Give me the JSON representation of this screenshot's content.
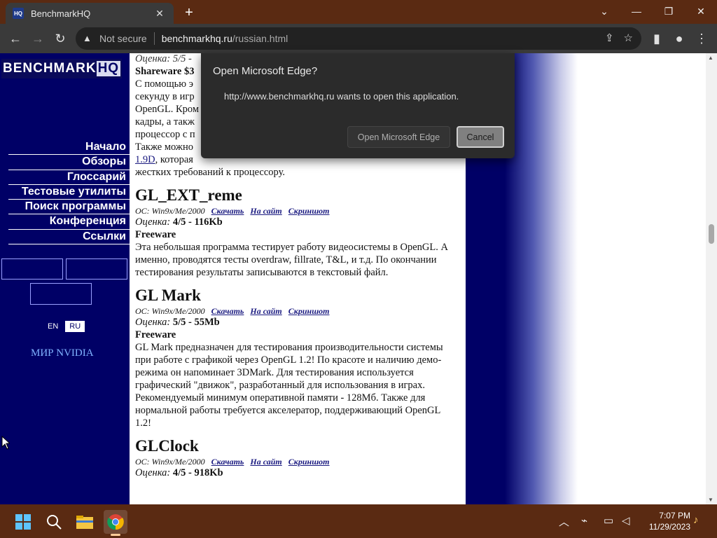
{
  "browser": {
    "tab_title": "BenchmarkHQ",
    "tab_favicon": "HQ",
    "address_security": "Not secure",
    "address_host": "benchmarkhq.ru",
    "address_path": "/russian.html"
  },
  "site": {
    "logo_main": "BENCHMARK",
    "logo_hq": "HQ",
    "nav": [
      "Начало",
      "Обзоры",
      "Глоссарий",
      "Тестовые утилиты",
      "Поиск программы",
      "Конференция",
      "Ссылки"
    ],
    "lang_en": "EN",
    "lang_ru": "RU",
    "mir_nvidia": "МИР NVIDIA"
  },
  "content": {
    "top_rating": "Оценка: 5/5 -",
    "top_license": "Shareware $3",
    "top_lines": [
      "С помощью э",
      "секунду в игр",
      "OpenGL. Кром",
      "кадры, а такж",
      "процессор с п",
      "Также можно"
    ],
    "top_link": "1.9D",
    "top_link_rest": ", которая",
    "top_last": "жестких требований к процессору.",
    "entries": [
      {
        "title": "GL_EXT_reme",
        "os": "ОС: Win9x/Me/2000",
        "download": "Скачать",
        "site": "На сайт",
        "screenshot": "Скриншот",
        "rating_label": "Оценка:",
        "rating_value": "4/5 - 116Kb",
        "license": "Freeware",
        "desc": "Эта небольшая программа тестирует работу видеосистемы в OpenGL. А именно, проводятся тесты overdraw, fillrate, T&L, и т.д. По окончании тестирования результаты записываются в текстовый файл."
      },
      {
        "title": "GL Mark",
        "os": "ОС: Win9x/Me/2000",
        "download": "Скачать",
        "site": "На сайт",
        "screenshot": "Скриншот",
        "rating_label": "Оценка:",
        "rating_value": "5/5 - 55Mb",
        "license": "Freeware",
        "desc": "GL Mark предназначен для тестирования производительности системы при работе с графикой через OpenGL 1.2! По красоте и наличию демо-режима он напоминает 3DMark. Для тестирования используется графический \"движок\", разработанный для использования в играх. Рекомендуемый минимум оперативной памяти - 128Мб. Также для нормальной работы требуется акселератор, поддерживающий OpenGL 1.2!"
      },
      {
        "title": "GLClock",
        "os": "ОС: Win9x/Me/2000",
        "download": "Скачать",
        "site": "На сайт",
        "screenshot": "Скриншот",
        "rating_label": "Оценка:",
        "rating_value": "4/5 - 918Kb"
      }
    ]
  },
  "dialog": {
    "title": "Open Microsoft Edge?",
    "message": "http://www.benchmarkhq.ru wants to open this application.",
    "open_button": "Open Microsoft Edge",
    "cancel_button": "Cancel"
  },
  "taskbar": {
    "time": "7:07 PM",
    "date": "11/29/2023"
  }
}
